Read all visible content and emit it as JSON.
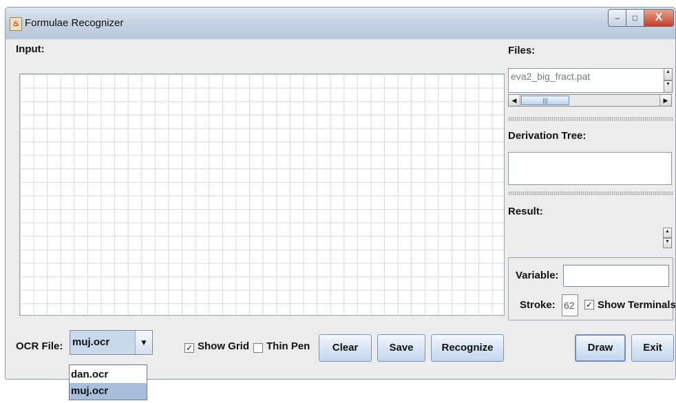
{
  "window": {
    "title": "Formulae Recognizer",
    "controls": {
      "minimize": "–",
      "maximize": "□",
      "close": "X"
    }
  },
  "app_icon_glyph": "♨",
  "input": {
    "label": "Input:"
  },
  "files": {
    "label": "Files:",
    "selected_file": "eva2_big_fract.pat",
    "scroll_thumb_grip": "|||"
  },
  "derivation_tree": {
    "label": "Derivation Tree:",
    "value": ""
  },
  "result": {
    "label": "Result:"
  },
  "variable": {
    "label": "Variable:",
    "value": ""
  },
  "stroke": {
    "label": "Stroke:",
    "value": "62"
  },
  "show_terminals": {
    "label": "Show Terminals",
    "checked": true
  },
  "ocr": {
    "label": "OCR File:",
    "selected": "muj.ocr",
    "options": [
      "dan.ocr",
      "muj.ocr"
    ]
  },
  "show_grid": {
    "label": "Show Grid",
    "checked": true
  },
  "thin_pen": {
    "label": "Thin Pen",
    "checked": false
  },
  "buttons": {
    "clear": "Clear",
    "save": "Save",
    "recognize": "Recognize",
    "draw": "Draw",
    "exit": "Exit"
  },
  "glyphs": {
    "check": "✓",
    "up": "▲",
    "down": "▼",
    "left": "◀",
    "right": "▶"
  }
}
